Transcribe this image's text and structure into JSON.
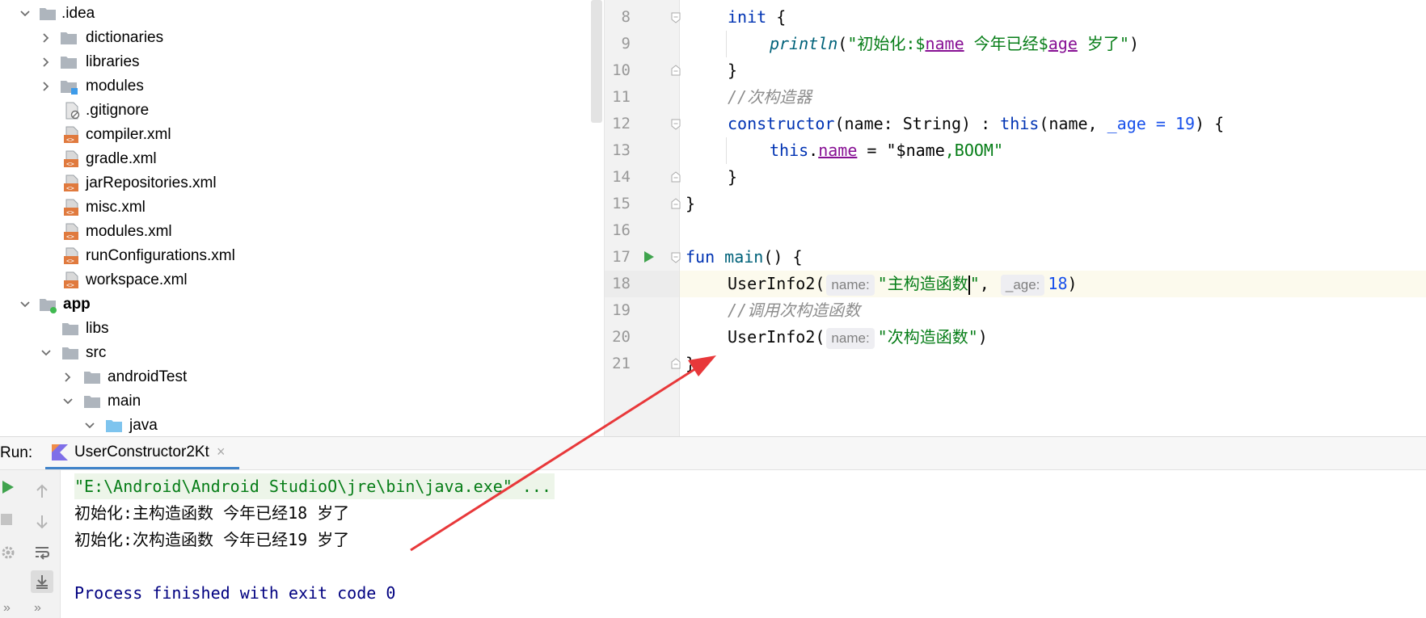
{
  "project_tree": {
    "items": [
      {
        "label": ".idea",
        "icon": "folder-icon",
        "expanded": true
      },
      {
        "label": "dictionaries",
        "icon": "folder-icon",
        "expanded": false
      },
      {
        "label": "libraries",
        "icon": "folder-icon",
        "expanded": false
      },
      {
        "label": "modules",
        "icon": "module-folder-icon",
        "expanded": false
      },
      {
        "label": ".gitignore",
        "icon": "ignored-file-icon"
      },
      {
        "label": "compiler.xml",
        "icon": "xml-file-icon"
      },
      {
        "label": "gradle.xml",
        "icon": "xml-file-icon"
      },
      {
        "label": "jarRepositories.xml",
        "icon": "xml-file-icon"
      },
      {
        "label": "misc.xml",
        "icon": "xml-file-icon"
      },
      {
        "label": "modules.xml",
        "icon": "xml-file-icon"
      },
      {
        "label": "runConfigurations.xml",
        "icon": "xml-file-icon"
      },
      {
        "label": "workspace.xml",
        "icon": "xml-file-icon"
      },
      {
        "label": "app",
        "icon": "module-icon",
        "expanded": true
      },
      {
        "label": "libs",
        "icon": "folder-icon"
      },
      {
        "label": "src",
        "icon": "folder-icon",
        "expanded": true
      },
      {
        "label": "androidTest",
        "icon": "folder-icon",
        "expanded": false
      },
      {
        "label": "main",
        "icon": "folder-icon",
        "expanded": true
      },
      {
        "label": "java",
        "icon": "source-folder-icon",
        "expanded": true
      }
    ]
  },
  "editor": {
    "line_numbers": [
      "8",
      "9",
      "10",
      "11",
      "12",
      "13",
      "14",
      "15",
      "16",
      "17",
      "18",
      "19",
      "20",
      "21"
    ],
    "code": {
      "l8_kw": "init",
      "l8_rest": " {",
      "l9_fn": "println",
      "l9_open": "(",
      "l9_s1": "\"初始化:$",
      "l9_p1": "name",
      "l9_s2": " 今年已经$",
      "l9_p2": "age",
      "l9_s3": " 岁了\"",
      "l9_close": ")",
      "l10": "}",
      "l11": "//次构造器",
      "l12_kw": "constructor",
      "l12_mid": "(name: String) : ",
      "l12_this": "this",
      "l12_args": "(name, ",
      "l12_param": "_age",
      "l12_eq": " = ",
      "l12_num": "19",
      "l12_end": ") {",
      "l13_this": "this",
      "l13_dot": ".",
      "l13_prop": "name",
      "l13_eq": " = ",
      "l13_s1": "\"$name",
      "l13_s2": ",BOOM\"",
      "l14": "}",
      "l15": "}",
      "l17_kw": "fun",
      "l17_fn": " main",
      "l17_rest": "() {",
      "l18_call": "UserInfo2(",
      "l18_hint1": "name:",
      "l18_s1": "\"主构造函数",
      "l18_s2": "\"",
      "l18_comma": ",",
      "l18_hint2": "_age:",
      "l18_num": "18",
      "l18_end": ")",
      "l19": "//调用次构造函数",
      "l20_call": "UserInfo2(",
      "l20_hint1": "name:",
      "l20_s1": "\"次构造函数\"",
      "l20_end": ")",
      "l21": "}"
    }
  },
  "run_panel": {
    "label": "Run:",
    "tab_title": "UserConstructor2Kt",
    "tab_close": "×",
    "output": [
      "\"E:\\Android\\Android StudioO\\jre\\bin\\java.exe\" ...",
      "初始化:主构造函数 今年已经18 岁了",
      "初始化:次构造函数 今年已经19 岁了",
      "",
      "Process finished with exit code 0"
    ],
    "more_glyph": "»"
  },
  "colors": {
    "keyword": "#0033b3",
    "string": "#067d17",
    "comment": "#8c8c8c",
    "property": "#871094",
    "number": "#1750eb",
    "annotation_arrow": "#e8383a"
  }
}
